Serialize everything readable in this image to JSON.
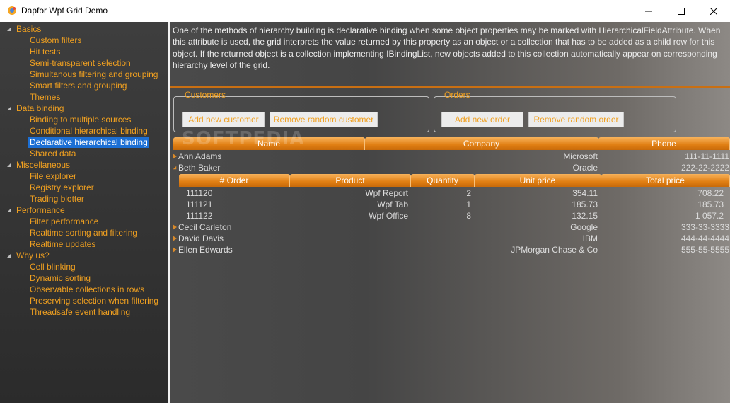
{
  "window": {
    "title": "Dapfor Wpf Grid Demo",
    "buttons": [
      "minimize",
      "maximize",
      "close"
    ]
  },
  "sidebar": {
    "groups": [
      {
        "label": "Basics",
        "items": [
          "Custom filters",
          "Hit tests",
          "Semi-transparent selection",
          "Simultanous filtering and grouping",
          "Smart filters and grouping",
          "Themes"
        ]
      },
      {
        "label": "Data binding",
        "items": [
          "Binding to multiple sources",
          "Conditional hierarchical binding",
          "Declarative hierarchical binding",
          "Shared data"
        ]
      },
      {
        "label": "Miscellaneous",
        "items": [
          "File explorer",
          "Registry explorer",
          "Trading blotter"
        ]
      },
      {
        "label": "Performance",
        "items": [
          "Filter performance",
          "Realtime sorting and filtering",
          "Realtime updates"
        ]
      },
      {
        "label": "Why us?",
        "items": [
          "Cell blinking",
          "Dynamic sorting",
          "Observable collections in rows",
          "Preserving selection when filtering",
          "Threadsafe event handling"
        ]
      }
    ],
    "selected": "Declarative hierarchical binding"
  },
  "description": "One of the methods of hierarchy building is declarative binding when some object properties may be marked with HierarchicalFieldAttribute. When this attribute is used, the grid interprets the value returned by this property as an object or a collection that has to be added as a child row for this object. If the returned object is a collection implementing IBindingList, new objects added to this collection automatically appear on corresponding hierarchy level of the grid.",
  "customers_box": {
    "title": "Customers",
    "add_label": "Add new customer",
    "remove_label": "Remove random customer"
  },
  "orders_box": {
    "title": "Orders",
    "add_label": "Add new order",
    "remove_label": "Remove random order"
  },
  "watermark": "SOFTPEDIA",
  "grid": {
    "columns": [
      "Name",
      "Company",
      "Phone"
    ],
    "rows": [
      {
        "name": "Ann Adams",
        "company": "Microsoft",
        "phone": "111-11-1111",
        "expanded": false
      },
      {
        "name": "Beth Baker",
        "company": "Oracle",
        "phone": "222-22-2222",
        "expanded": true
      },
      {
        "name": "Cecil Carleton",
        "company": "Google",
        "phone": "333-33-3333",
        "expanded": false
      },
      {
        "name": "David Davis",
        "company": "IBM",
        "phone": "444-44-4444",
        "expanded": false
      },
      {
        "name": "Ellen Edwards",
        "company": "JPMorgan Chase & Co",
        "phone": "555-55-5555",
        "expanded": false
      }
    ],
    "child": {
      "columns": [
        "# Order",
        "Product",
        "Quantity",
        "Unit price",
        "Total price"
      ],
      "rows": [
        {
          "order": "111120",
          "product": "Wpf Report",
          "quantity": "2",
          "unit": "354.11",
          "total": "708.22"
        },
        {
          "order": "111121",
          "product": "Wpf Tab",
          "quantity": "1",
          "unit": "185.73",
          "total": "185.73"
        },
        {
          "order": "111122",
          "product": "Wpf Office",
          "quantity": "8",
          "unit": "132.15",
          "total": "1 057.2"
        }
      ]
    }
  },
  "colors": {
    "accent": "#f0a020",
    "header_orange": "#e07f13",
    "selection": "#1c6fd4"
  }
}
